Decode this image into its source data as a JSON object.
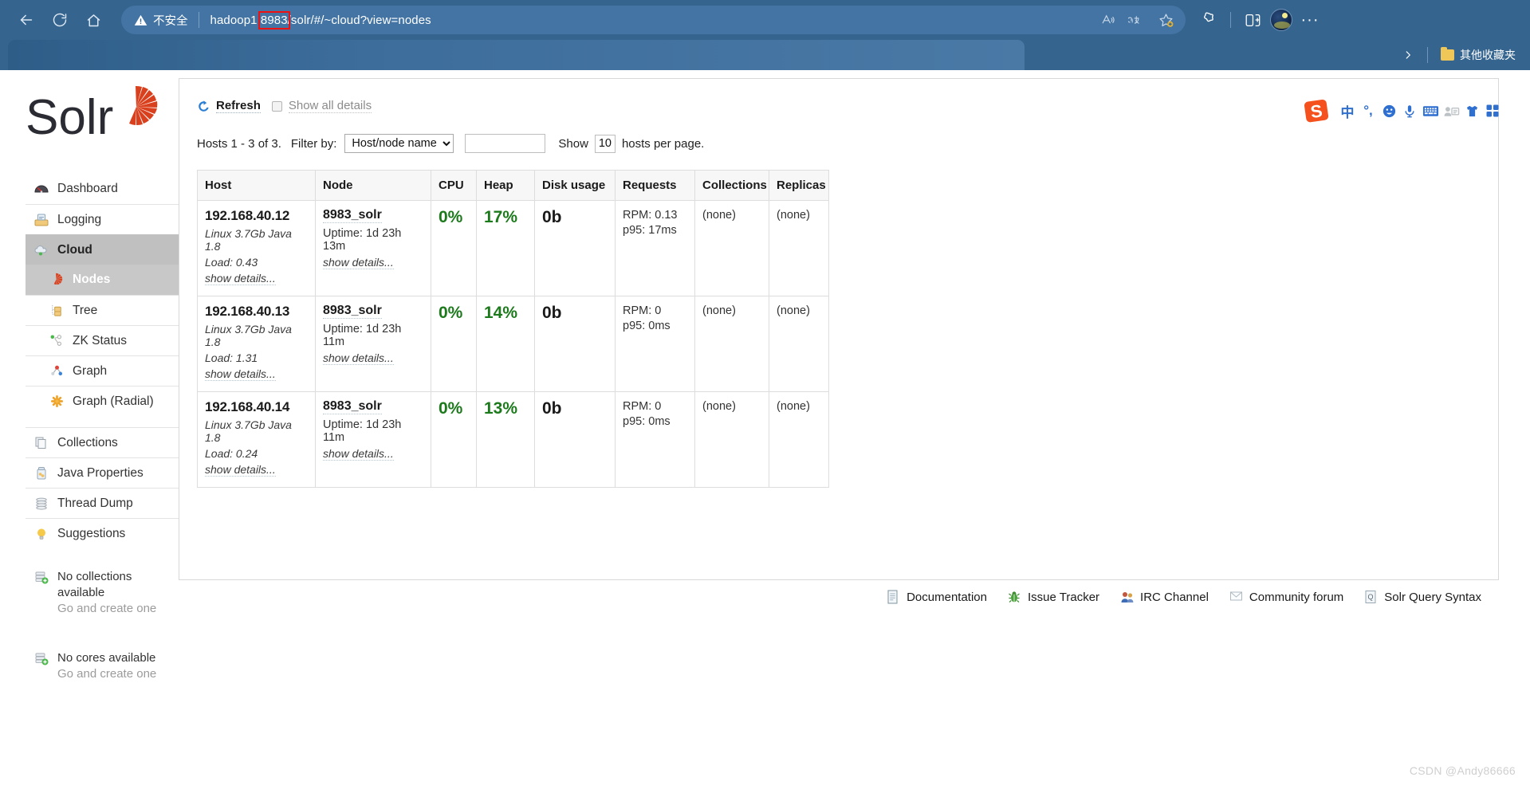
{
  "browser": {
    "back_label": "Back",
    "refresh_label": "Refresh",
    "home_label": "Home",
    "security_warning": "不安全",
    "url_prefix": "hadoop1:",
    "url_highlight": "8983",
    "url_suffix": "/solr/#/~cloud?view=nodes",
    "read_aloud_label": "A",
    "translate_label": "aあ",
    "favorites_label": "☆",
    "collections_label": "Collections",
    "split_screen_label": "Split screen",
    "more_label": "···",
    "bookmarks_chevron": "❯",
    "other_favorites": "其他收藏夹"
  },
  "sidebar": {
    "logo_text": "Solr",
    "items": [
      {
        "label": "Dashboard",
        "icon": "dashboard-icon",
        "active": false,
        "sub": false
      },
      {
        "label": "Logging",
        "icon": "logging-icon",
        "active": false,
        "sub": false
      },
      {
        "label": "Cloud",
        "icon": "cloud-icon",
        "active": true,
        "sub": false
      },
      {
        "label": "Nodes",
        "icon": "nodes-icon",
        "active": true,
        "sub": true
      },
      {
        "label": "Tree",
        "icon": "tree-icon",
        "active": false,
        "sub": true
      },
      {
        "label": "ZK Status",
        "icon": "zk-status-icon",
        "active": false,
        "sub": true
      },
      {
        "label": "Graph",
        "icon": "graph-icon",
        "active": false,
        "sub": true
      },
      {
        "label": "Graph (Radial)",
        "icon": "graph-radial-icon",
        "active": false,
        "sub": true
      },
      {
        "label": "Collections",
        "icon": "collections-icon",
        "active": false,
        "sub": false
      },
      {
        "label": "Java Properties",
        "icon": "java-properties-icon",
        "active": false,
        "sub": false
      },
      {
        "label": "Thread Dump",
        "icon": "thread-dump-icon",
        "active": false,
        "sub": false
      },
      {
        "label": "Suggestions",
        "icon": "suggestions-icon",
        "active": false,
        "sub": false
      }
    ],
    "no_collections": {
      "title": "No collections available",
      "action": "Go and create one"
    },
    "no_cores": {
      "title": "No cores available",
      "action": "Go and create one"
    }
  },
  "main": {
    "refresh_label": "Refresh",
    "show_all_details_label": "Show all details",
    "show_all_details_checked": false,
    "hosts_count_text": "Hosts 1 - 3 of 3.",
    "filter_by_label": "Filter by:",
    "filter_select_value": "Host/node name",
    "filter_select_options": [
      "Host/node name"
    ],
    "filter_input_value": "",
    "filter_input_placeholder": "",
    "show_label": "Show",
    "per_page_value": "10",
    "per_page_suffix": "hosts per page.",
    "table": {
      "columns": [
        "Host",
        "Node",
        "CPU",
        "Heap",
        "Disk usage",
        "Requests",
        "Collections",
        "Replicas"
      ],
      "rows": [
        {
          "host_ip": "192.168.40.12",
          "host_info": "Linux 3.7Gb Java 1.8",
          "host_load": "Load: 0.43",
          "host_show_details": "show details...",
          "node_name": "8983_solr",
          "node_uptime": "Uptime: 1d 23h 13m",
          "node_show_details": "show details...",
          "cpu": "0%",
          "heap": "17%",
          "disk": "0b",
          "req_rpm": "RPM: 0.13",
          "req_p95": "p95: 17ms",
          "collections": "(none)",
          "replicas": "(none)"
        },
        {
          "host_ip": "192.168.40.13",
          "host_info": "Linux 3.7Gb Java 1.8",
          "host_load": "Load: 1.31",
          "host_show_details": "show details...",
          "node_name": "8983_solr",
          "node_uptime": "Uptime: 1d 23h 11m",
          "node_show_details": "show details...",
          "cpu": "0%",
          "heap": "14%",
          "disk": "0b",
          "req_rpm": "RPM: 0",
          "req_p95": "p95: 0ms",
          "collections": "(none)",
          "replicas": "(none)"
        },
        {
          "host_ip": "192.168.40.14",
          "host_info": "Linux 3.7Gb Java 1.8",
          "host_load": "Load: 0.24",
          "host_show_details": "show details...",
          "node_name": "8983_solr",
          "node_uptime": "Uptime: 1d 23h 11m",
          "node_show_details": "show details...",
          "cpu": "0%",
          "heap": "13%",
          "disk": "0b",
          "req_rpm": "RPM: 0",
          "req_p95": "p95: 0ms",
          "collections": "(none)",
          "replicas": "(none)"
        }
      ]
    }
  },
  "footer": {
    "links": [
      {
        "label": "Documentation",
        "icon": "document-icon"
      },
      {
        "label": "Issue Tracker",
        "icon": "bug-icon"
      },
      {
        "label": "IRC Channel",
        "icon": "people-icon"
      },
      {
        "label": "Community forum",
        "icon": "envelope-icon"
      },
      {
        "label": "Solr Query Syntax",
        "icon": "query-icon"
      }
    ]
  },
  "ime": {
    "logo_label": "S",
    "mode_label": "中",
    "punctuation_label": "°,",
    "icons": [
      "sogou-logo-icon",
      "chinese-mode-icon",
      "punctuation-icon",
      "emoji-icon",
      "microphone-icon",
      "keyboard-icon",
      "user-card-icon",
      "skin-icon",
      "apps-icon"
    ]
  },
  "watermark": "CSDN @Andy86666",
  "colors": {
    "chrome_blue": "#35658f",
    "addressbar_blue": "#4374a3",
    "green_metric": "#1c7a1c",
    "solr_red": "#d9411e",
    "sidebar_active": "#c0c0c0"
  }
}
